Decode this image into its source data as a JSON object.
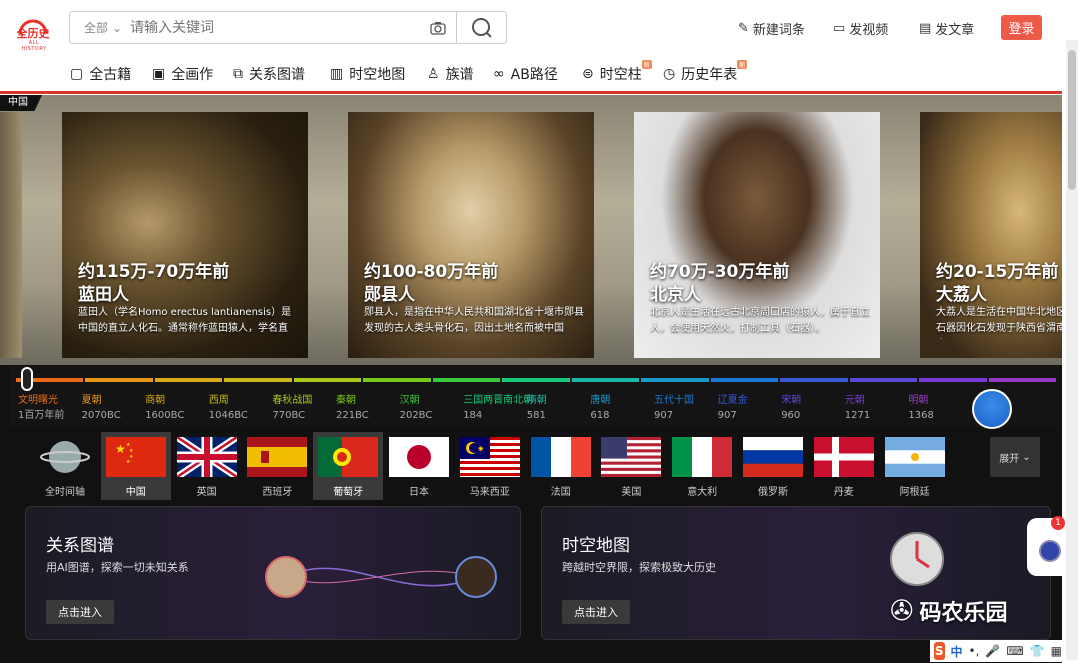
{
  "header": {
    "logo_text": "全历史",
    "logo_sub": "ALL HISTORY",
    "search_scope": "全部",
    "search_placeholder": "请输入关键词",
    "links": [
      "新建词条",
      "发视频",
      "发文章"
    ],
    "login": "登录"
  },
  "nav": [
    {
      "label": "全古籍",
      "icon": "book-icon",
      "badge": ""
    },
    {
      "label": "全画作",
      "icon": "painting-icon",
      "badge": ""
    },
    {
      "label": "关系图谱",
      "icon": "graph-icon",
      "badge": ""
    },
    {
      "label": "时空地图",
      "icon": "map-icon",
      "badge": ""
    },
    {
      "label": "族谱",
      "icon": "family-icon",
      "badge": ""
    },
    {
      "label": "AB路径",
      "icon": "path-icon",
      "badge": ""
    },
    {
      "label": "时空柱",
      "icon": "pillar-icon",
      "badge": "新"
    },
    {
      "label": "历史年表",
      "icon": "clock-icon",
      "badge": "新"
    }
  ],
  "region_tag": "中国",
  "cards": [
    {
      "period": "约115万-70万年前",
      "name": "蓝田人",
      "desc": "蓝田人（学名Homo erectus lantianensis）是中国的直立人化石。通常称作蓝田猿人，学名直"
    },
    {
      "period": "约100-80万年前",
      "name": "郧县人",
      "desc": "郧县人，是指在中华人民共和国湖北省十堰市郧县发现的古人类头骨化石，因出土地名而被中国"
    },
    {
      "period": "约70万-30万年前",
      "name": "北京人",
      "desc": "北京人是生活在远古北京周口店的猿人，属于直立人，会使用天然火，打制工具（石器）。"
    },
    {
      "period": "约20-15万年前",
      "name": "大荔人",
      "desc": "大荔人是生活在中国华北地区旧石器因化石发现于陕西省渭南市大"
    }
  ],
  "timeline": [
    {
      "name": "文明曙光",
      "year": "1百万年前",
      "color": "#e86a1a"
    },
    {
      "name": "夏朝",
      "year": "2070BC",
      "color": "#e8961a"
    },
    {
      "name": "商朝",
      "year": "1600BC",
      "color": "#d8a81a"
    },
    {
      "name": "西周",
      "year": "1046BC",
      "color": "#c8b81a"
    },
    {
      "name": "春秋战国",
      "year": "770BC",
      "color": "#a8c81a"
    },
    {
      "name": "秦朝",
      "year": "221BC",
      "color": "#78c81a"
    },
    {
      "name": "汉朝",
      "year": "202BC",
      "color": "#38c83a"
    },
    {
      "name": "三国两晋南北朝",
      "year": "184",
      "color": "#1ac87a"
    },
    {
      "name": "隋朝",
      "year": "581",
      "color": "#1ab8a8"
    },
    {
      "name": "唐朝",
      "year": "618",
      "color": "#1a98c8"
    },
    {
      "name": "五代十国",
      "year": "907",
      "color": "#1a78d8"
    },
    {
      "name": "辽夏金",
      "year": "907",
      "color": "#3a58d8"
    },
    {
      "name": "宋朝",
      "year": "960",
      "color": "#5a48d8"
    },
    {
      "name": "元朝",
      "year": "1271",
      "color": "#7a38d8"
    },
    {
      "name": "明朝",
      "year": "1368",
      "color": "#9a38c8"
    }
  ],
  "countries": [
    {
      "label": "全时间轴",
      "selected": false
    },
    {
      "label": "中国",
      "selected": true
    },
    {
      "label": "英国",
      "selected": false
    },
    {
      "label": "西班牙",
      "selected": false
    },
    {
      "label": "葡萄牙",
      "selected": true
    },
    {
      "label": "日本",
      "selected": false
    },
    {
      "label": "马来西亚",
      "selected": false
    },
    {
      "label": "法国",
      "selected": false
    },
    {
      "label": "美国",
      "selected": false
    },
    {
      "label": "意大利",
      "selected": false
    },
    {
      "label": "俄罗斯",
      "selected": false
    },
    {
      "label": "丹麦",
      "selected": false
    },
    {
      "label": "阿根廷",
      "selected": false
    }
  ],
  "expand_label": "展开",
  "panels": [
    {
      "title": "关系图谱",
      "subtitle": "用AI图谱，探索一切未知关系",
      "button": "点击进入"
    },
    {
      "title": "时空地图",
      "subtitle": "跨越时空界限，探索极致大历史",
      "button": "点击进入"
    }
  ],
  "watermark": "码农乐园",
  "side_badge": "1",
  "ime_text": "中"
}
